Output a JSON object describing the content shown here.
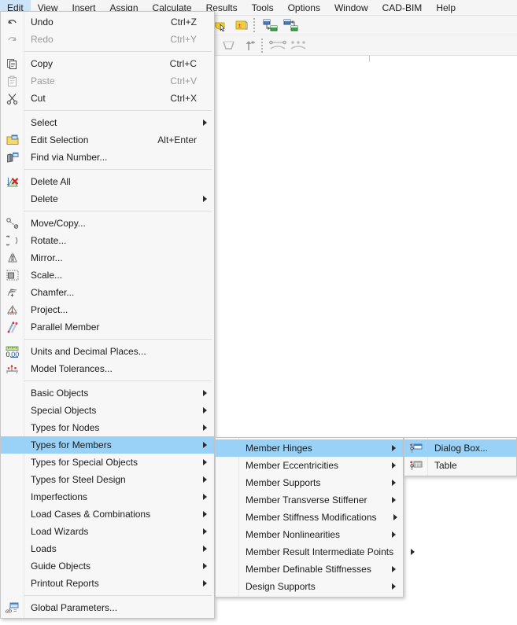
{
  "app": {
    "accent_highlight": "#99d1f7",
    "menubar_highlight": "#cce4f7",
    "background": "#ffffff"
  },
  "menubar": {
    "items": [
      {
        "label": "Edit",
        "active": true
      },
      {
        "label": "View",
        "active": false
      },
      {
        "label": "Insert",
        "active": false
      },
      {
        "label": "Assign",
        "active": false
      },
      {
        "label": "Calculate",
        "active": false
      },
      {
        "label": "Results",
        "active": false
      },
      {
        "label": "Tools",
        "active": false
      },
      {
        "label": "Options",
        "active": false
      },
      {
        "label": "Window",
        "active": false
      },
      {
        "label": "CAD-BIM",
        "active": false
      },
      {
        "label": "Help",
        "active": false
      }
    ]
  },
  "toolbar_row1": {
    "buttons": [
      {
        "icon": "navigator-panel-icon",
        "selected": true
      },
      {
        "icon": "data-table-panel-icon",
        "selected": true
      },
      {
        "icon": "list-panel-icon",
        "selected": false
      },
      {
        "icon": "command-console-icon",
        "selected": false
      },
      {
        "icon": "script-console-icon",
        "selected": false
      },
      {
        "icon": "printout-report-icon",
        "selected": false
      },
      {
        "icon": "surface-select-icon",
        "selected": false
      },
      {
        "icon": "node-snap-icon",
        "selected": false
      },
      {
        "icon": "circle-snap-icon",
        "selected": false
      },
      {
        "icon": "pointer-select-icon",
        "selected": false
      },
      {
        "icon": "numbering-box-icon",
        "selected": false
      },
      {
        "icon": "model-link-1-icon",
        "selected": false
      },
      {
        "icon": "model-link-2-icon",
        "selected": false
      }
    ]
  },
  "toolbar_row2": {
    "buttons": [
      {
        "icon": "new-node-icon",
        "selected": false
      },
      {
        "icon": "new-member-icon",
        "selected": false
      },
      {
        "icon": "new-member-set-icon",
        "selected": false
      },
      {
        "icon": "new-surface-icon",
        "selected": false
      },
      {
        "icon": "new-solid-icon",
        "selected": false
      },
      {
        "icon": "filter-icon",
        "selected": false
      },
      {
        "icon": "member-hinge-release-icon",
        "selected": false
      },
      {
        "icon": "member-support-icon",
        "selected": false
      },
      {
        "icon": "line-hinge-icon",
        "selected": false
      },
      {
        "icon": "nodal-support-up-icon",
        "selected": false
      },
      {
        "icon": "member-eccentricity-icon",
        "selected": false
      },
      {
        "icon": "member-divide-icon",
        "selected": false
      }
    ]
  },
  "menu_edit": {
    "name": "Edit",
    "items": [
      {
        "label": "Undo",
        "accel": "Ctrl+Z",
        "icon": "undo-icon",
        "disabled": false,
        "submenu": false
      },
      {
        "label": "Redo",
        "accel": "Ctrl+Y",
        "icon": "redo-icon",
        "disabled": true,
        "submenu": false
      },
      {
        "separator": true
      },
      {
        "label": "Copy",
        "accel": "Ctrl+C",
        "icon": "copy-icon",
        "disabled": false,
        "submenu": false
      },
      {
        "label": "Paste",
        "accel": "Ctrl+V",
        "icon": "paste-icon",
        "disabled": true,
        "submenu": false
      },
      {
        "label": "Cut",
        "accel": "Ctrl+X",
        "icon": "cut-icon",
        "disabled": false,
        "submenu": false
      },
      {
        "separator": true
      },
      {
        "label": "Select",
        "accel": "",
        "icon": "",
        "disabled": false,
        "submenu": true
      },
      {
        "label": "Edit Selection",
        "accel": "Alt+Enter",
        "icon": "edit-selection-icon",
        "disabled": false,
        "submenu": false
      },
      {
        "label": "Find via Number...",
        "accel": "",
        "icon": "find-number-icon",
        "disabled": false,
        "submenu": false
      },
      {
        "separator": true
      },
      {
        "label": "Delete All",
        "accel": "",
        "icon": "delete-all-icon",
        "disabled": false,
        "submenu": false
      },
      {
        "label": "Delete",
        "accel": "",
        "icon": "",
        "disabled": false,
        "submenu": true
      },
      {
        "separator": true
      },
      {
        "label": "Move/Copy...",
        "accel": "",
        "icon": "move-copy-icon",
        "disabled": false,
        "submenu": false
      },
      {
        "label": "Rotate...",
        "accel": "",
        "icon": "rotate-icon",
        "disabled": false,
        "submenu": false
      },
      {
        "label": "Mirror...",
        "accel": "",
        "icon": "mirror-icon",
        "disabled": false,
        "submenu": false
      },
      {
        "label": "Scale...",
        "accel": "",
        "icon": "scale-icon",
        "disabled": false,
        "submenu": false
      },
      {
        "label": "Chamfer...",
        "accel": "",
        "icon": "chamfer-icon",
        "disabled": false,
        "submenu": false
      },
      {
        "label": "Project...",
        "accel": "",
        "icon": "project-icon",
        "disabled": false,
        "submenu": false
      },
      {
        "label": "Parallel Member",
        "accel": "",
        "icon": "parallel-member-icon",
        "disabled": false,
        "submenu": false
      },
      {
        "separator": true
      },
      {
        "label": "Units and Decimal Places...",
        "accel": "",
        "icon": "units-icon",
        "disabled": false,
        "submenu": false
      },
      {
        "label": "Model Tolerances...",
        "accel": "",
        "icon": "tolerances-icon",
        "disabled": false,
        "submenu": false
      },
      {
        "separator": true
      },
      {
        "label": "Basic Objects",
        "accel": "",
        "icon": "",
        "disabled": false,
        "submenu": true
      },
      {
        "label": "Special Objects",
        "accel": "",
        "icon": "",
        "disabled": false,
        "submenu": true
      },
      {
        "label": "Types for Nodes",
        "accel": "",
        "icon": "",
        "disabled": false,
        "submenu": true
      },
      {
        "label": "Types for Members",
        "accel": "",
        "icon": "",
        "disabled": false,
        "submenu": true,
        "highlighted": true
      },
      {
        "label": "Types for Special Objects",
        "accel": "",
        "icon": "",
        "disabled": false,
        "submenu": true
      },
      {
        "label": "Types for Steel Design",
        "accel": "",
        "icon": "",
        "disabled": false,
        "submenu": true
      },
      {
        "label": "Imperfections",
        "accel": "",
        "icon": "",
        "disabled": false,
        "submenu": true
      },
      {
        "label": "Load Cases & Combinations",
        "accel": "",
        "icon": "",
        "disabled": false,
        "submenu": true
      },
      {
        "label": "Load Wizards",
        "accel": "",
        "icon": "",
        "disabled": false,
        "submenu": true
      },
      {
        "label": "Loads",
        "accel": "",
        "icon": "",
        "disabled": false,
        "submenu": true
      },
      {
        "label": "Guide Objects",
        "accel": "",
        "icon": "",
        "disabled": false,
        "submenu": true
      },
      {
        "label": "Printout Reports",
        "accel": "",
        "icon": "",
        "disabled": false,
        "submenu": true
      },
      {
        "separator": true
      },
      {
        "label": "Global Parameters...",
        "accel": "",
        "icon": "global-parameters-icon",
        "disabled": false,
        "submenu": false
      }
    ]
  },
  "menu_types_for_members": {
    "name": "Types for Members",
    "items": [
      {
        "label": "Member Hinges",
        "submenu": true,
        "highlighted": true
      },
      {
        "label": "Member Eccentricities",
        "submenu": true
      },
      {
        "label": "Member Supports",
        "submenu": true
      },
      {
        "label": "Member Transverse Stiffener",
        "submenu": true
      },
      {
        "label": "Member Stiffness Modifications",
        "submenu": true
      },
      {
        "label": "Member Nonlinearities",
        "submenu": true
      },
      {
        "label": "Member Result Intermediate Points",
        "submenu": true
      },
      {
        "label": "Member Definable Stiffnesses",
        "submenu": true
      },
      {
        "label": "Design Supports",
        "submenu": true
      }
    ]
  },
  "menu_member_hinges": {
    "name": "Member Hinges",
    "items": [
      {
        "label": "Dialog Box...",
        "icon": "dialog-box-icon",
        "highlighted": true
      },
      {
        "label": "Table",
        "icon": "table-icon",
        "highlighted": false
      }
    ]
  }
}
